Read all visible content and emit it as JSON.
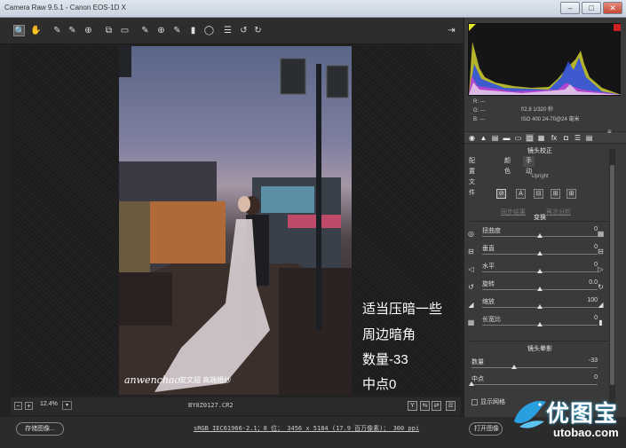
{
  "window": {
    "title": "Camera Raw 9.5.1 - Canon EOS-1D X",
    "minimize": "–",
    "maximize": "□",
    "close": "✕"
  },
  "toolbar": {
    "tools": [
      "zoom-icon",
      "hand-icon",
      "white-balance-icon",
      "color-sampler-icon",
      "target-adjust-icon",
      "crop-icon",
      "straighten-icon",
      "spot-removal-icon",
      "red-eye-icon",
      "adjustment-brush-icon",
      "graduated-filter-icon",
      "radial-filter-icon",
      "presets-list-icon",
      "rotate-ccw-icon",
      "rotate-cw-icon"
    ],
    "glyphs": [
      "🔍",
      "✋",
      "✎",
      "✎",
      "⊕",
      "⧉",
      "▭",
      "✎",
      "⊕",
      "✎",
      "▮",
      "◯",
      "☰",
      "↺",
      "↻"
    ],
    "export_glyph": "⇥"
  },
  "captions": [
    "适当压暗一些",
    "周边暗角",
    "数量-33",
    "中点0"
  ],
  "watermark": {
    "logo": "anwenchao",
    "cn": "安文超 高端婚纱"
  },
  "statusbar": {
    "zoom_minus": "−",
    "zoom_plus": "+",
    "zoom": "12.4%",
    "zoom_drop": "▾",
    "filename": "BY0Z0127.CR2",
    "icons": [
      "Y",
      "⇆",
      "⇄",
      "☰"
    ]
  },
  "bottom": {
    "save_label": "存储图像...",
    "workflow": "sRGB IEC61966-2.1；8 位； 3456 x 5184 (17.9 百万像素)； 300 ppi",
    "open_label": "打开图像"
  },
  "histogram": {
    "readout_r": "R:  ---",
    "readout_g": "G:  ---",
    "readout_b": "B:  ---",
    "exposure": "f/2.8   1/320 秒",
    "iso_lens": "ISO 400   24-70@24 毫米"
  },
  "panel": {
    "tab_glyphs": [
      "◉",
      "▲",
      "▤",
      "▬",
      "▭",
      "▥",
      "▦",
      "fx",
      "◘",
      "☰",
      "▤"
    ],
    "menu_glyph": "≡",
    "title": "镜头校正",
    "subtabs": [
      "配置文件",
      "颜色",
      "手动"
    ],
    "upright_label": "Upright",
    "upright_buttons": [
      "⊘",
      "A",
      "⊟",
      "⊞",
      "⊞"
    ],
    "redo_analysis": "再次分析",
    "update": "同步结果",
    "transform_title": "变换",
    "transform": [
      {
        "label": "扭曲度",
        "value": "0",
        "pos": 0.5,
        "left": "◎",
        "right": "▦"
      },
      {
        "label": "垂直",
        "value": "0",
        "pos": 0.5,
        "left": "⊟",
        "right": "⊟"
      },
      {
        "label": "水平",
        "value": "0",
        "pos": 0.5,
        "left": "◁",
        "right": "▷"
      },
      {
        "label": "旋转",
        "value": "0.0",
        "pos": 0.5,
        "left": "↺",
        "right": "↻"
      },
      {
        "label": "缩放",
        "value": "100",
        "pos": 0.5,
        "left": "◢",
        "right": "◢"
      },
      {
        "label": "长宽比",
        "value": "0",
        "pos": 0.5,
        "left": "▦",
        "right": "▮"
      }
    ],
    "vignette_title": "镜头晕影",
    "vignette": [
      {
        "label": "数量",
        "value": "-33",
        "pos": 0.335
      },
      {
        "label": "中点",
        "value": "0",
        "pos": 0.0
      }
    ],
    "show_grid": "显示网格"
  },
  "site": {
    "cn": "优图宝",
    "en": "utobao.com"
  }
}
